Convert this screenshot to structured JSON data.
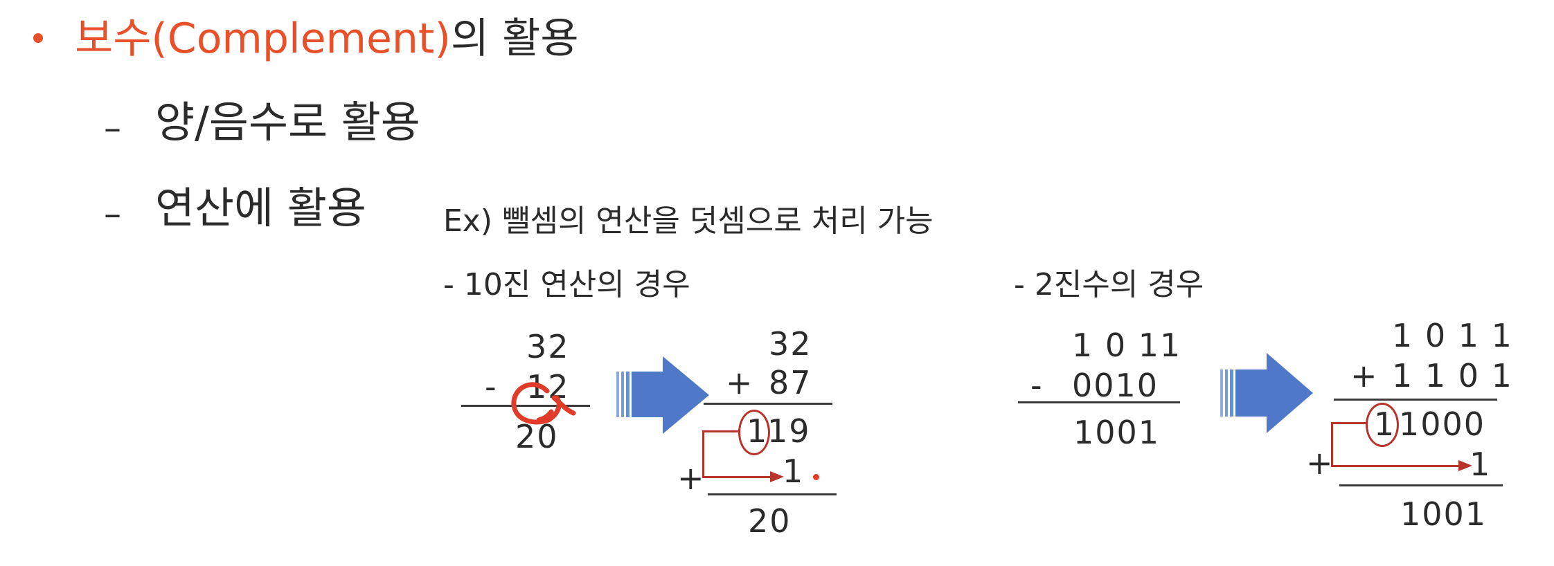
{
  "heading": {
    "prefix": "보수(Complement)",
    "suffix": "의 활용"
  },
  "bullets": [
    {
      "dash": "–",
      "text": "양/음수로 활용"
    },
    {
      "dash": "–",
      "text": "연산에 활용"
    }
  ],
  "example_title": "Ex)  뺄셈의 연산을 덧셈으로 처리 가능",
  "decimal": {
    "label": "- 10진 연산의 경우",
    "sub": {
      "a": "32",
      "op": "-",
      "b": "12",
      "result": "20"
    },
    "add": {
      "a": "32",
      "op": "+",
      "b": "87",
      "carry": "1",
      "partial": "19",
      "plus": "+",
      "one": "1",
      "result": "20"
    }
  },
  "binary": {
    "label": "-  2진수의 경우",
    "sub": {
      "a": "1 0 11",
      "op": "-",
      "b": "0010",
      "result": "1001"
    },
    "add": {
      "a": "1 0 1 1",
      "op": "+",
      "b": "1 1 0 1",
      "carry": "1",
      "partial": "1000",
      "plus": "+",
      "one": "1",
      "result": "1001"
    }
  },
  "colors": {
    "accent": "#e8502a",
    "arrow": "#4f79c8",
    "annotation": "#b8332a"
  }
}
